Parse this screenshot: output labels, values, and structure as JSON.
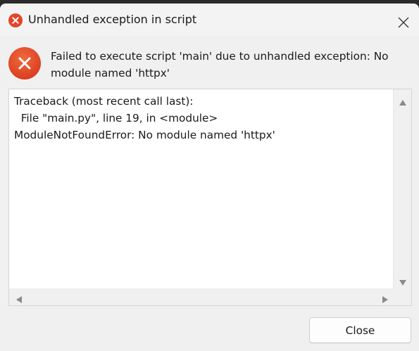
{
  "window": {
    "title": "Unhandled exception in script",
    "title_icon": "error-icon"
  },
  "message": {
    "text": "Failed to execute script 'main' due to unhandled exception: No module named 'httpx'",
    "icon": "error-icon"
  },
  "traceback": {
    "lines": [
      "Traceback (most recent call last):",
      "  File \"main.py\", line 19, in <module>",
      "ModuleNotFoundError: No module named 'httpx'"
    ]
  },
  "buttons": {
    "close_label": "Close"
  },
  "colors": {
    "error_red": "#e2462a",
    "background": "#f0f0f0"
  }
}
